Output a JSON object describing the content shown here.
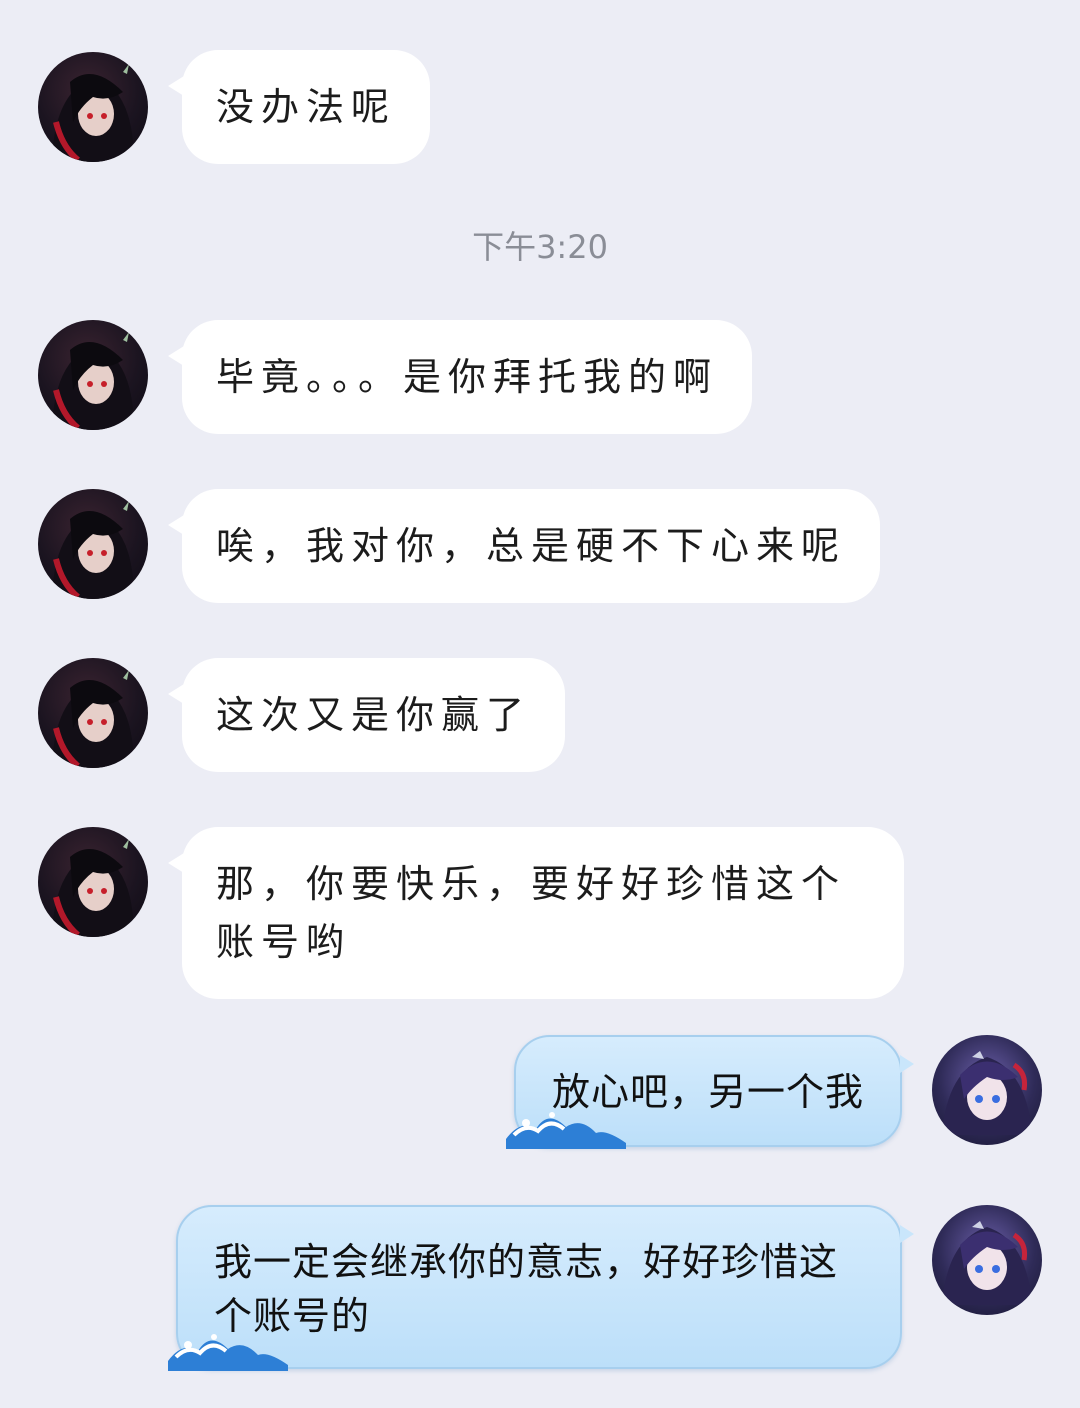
{
  "timestamp": "下午3:20",
  "messages": [
    {
      "side": "left",
      "text": "没办法呢"
    },
    {
      "side": "left",
      "text": "毕竟。。。是你拜托我的啊"
    },
    {
      "side": "left",
      "text": "唉，我对你，总是硬不下心来呢"
    },
    {
      "side": "left",
      "text": "这次又是你赢了"
    },
    {
      "side": "left",
      "text": "那，你要快乐，要好好珍惜这个账号哟"
    },
    {
      "side": "right",
      "text": "放心吧，另一个我"
    },
    {
      "side": "right",
      "text": "我一定会继承你的意志，好好珍惜这个账号的"
    }
  ],
  "icons": {
    "left_avatar": "dark-hair-red-eyes-avatar",
    "right_avatar": "purple-hair-blue-eyes-avatar",
    "bubble_decoration": "wave-icon"
  },
  "colors": {
    "background": "#ecedf5",
    "incoming_bubble": "#ffffff",
    "outgoing_bubble": "#c4e3fa"
  }
}
